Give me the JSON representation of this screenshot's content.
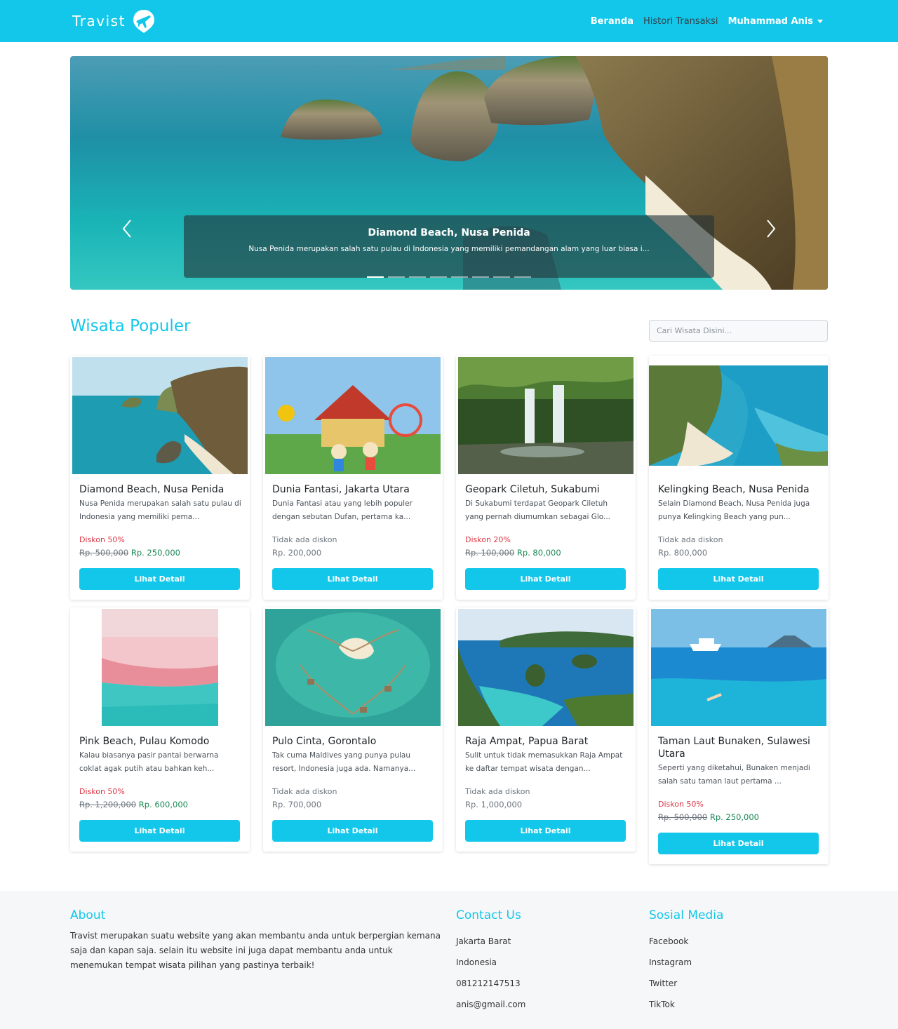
{
  "navbar": {
    "brand": "Travist",
    "links": [
      {
        "label": "Beranda"
      },
      {
        "label": "Histori Transaksi"
      },
      {
        "label": "Muhammad Anis"
      }
    ]
  },
  "carousel": {
    "caption_title": "Diamond Beach, Nusa Penida",
    "caption_text": "Nusa Penida merupakan salah satu pulau di Indonesia yang memiliki pemandangan alam yang luar biasa i...",
    "slide_count": 8,
    "active_index": 0
  },
  "section": {
    "title": "Wisata Populer",
    "search_placeholder": "Cari Wisata Disini..."
  },
  "cards": [
    {
      "title": "Diamond Beach, Nusa Penida",
      "desc": "Nusa Penida merupakan salah satu pulau di Indonesia yang memiliki pema...",
      "discount": "Diskon 50%",
      "old_price": "Rp. 500,000",
      "price": "Rp. 250,000",
      "button": "Lihat Detail"
    },
    {
      "title": "Dunia Fantasi, Jakarta Utara",
      "desc": "Dunia Fantasi atau yang lebih populer dengan sebutan Dufan, pertama ka...",
      "discount": "Tidak ada diskon",
      "old_price": "",
      "price": "Rp. 200,000",
      "button": "Lihat Detail"
    },
    {
      "title": "Geopark Ciletuh, Sukabumi",
      "desc": "Di Sukabumi terdapat Geopark Ciletuh yang pernah diumumkan sebagai Glo...",
      "discount": "Diskon 20%",
      "old_price": "Rp. 100,000",
      "price": "Rp. 80,000",
      "button": "Lihat Detail"
    },
    {
      "title": "Kelingking Beach, Nusa Penida",
      "desc": "Selain Diamond Beach, Nusa Penida juga punya Kelingking Beach yang pun...",
      "discount": "Tidak ada diskon",
      "old_price": "",
      "price": "Rp. 800,000",
      "button": "Lihat Detail"
    },
    {
      "title": "Pink Beach, Pulau Komodo",
      "desc": "Kalau biasanya pasir pantai berwarna coklat agak putih atau bahkan keh...",
      "discount": "Diskon 50%",
      "old_price": "Rp. 1,200,000",
      "price": "Rp. 600,000",
      "button": "Lihat Detail"
    },
    {
      "title": "Pulo Cinta, Gorontalo",
      "desc": "Tak cuma Maldives yang punya pulau resort, Indonesia juga ada. Namanya...",
      "discount": "Tidak ada diskon",
      "old_price": "",
      "price": "Rp. 700,000",
      "button": "Lihat Detail"
    },
    {
      "title": "Raja Ampat, Papua Barat",
      "desc": "Sulit untuk tidak memasukkan Raja Ampat ke daftar tempat wisata dengan...",
      "discount": "Tidak ada diskon",
      "old_price": "",
      "price": "Rp. 1,000,000",
      "button": "Lihat Detail"
    },
    {
      "title": "Taman Laut Bunaken, Sulawesi Utara",
      "desc": "Seperti yang diketahui, Bunaken menjadi salah satu taman laut pertama ...",
      "discount": "Diskon 50%",
      "old_price": "Rp. 500,000",
      "price": "Rp. 250,000",
      "button": "Lihat Detail"
    }
  ],
  "footer": {
    "about_title": "About",
    "about_text": "Travist merupakan suatu website yang akan membantu anda untuk berpergian kemana saja dan kapan saja. selain itu website ini juga dapat membantu anda untuk menemukan tempat wisata pilihan yang pastinya terbaik!",
    "contact_title": "Contact Us",
    "contact_items": [
      "Jakarta Barat",
      "Indonesia",
      "081212147513",
      "anis@gmail.com"
    ],
    "social_title": "Sosial Media",
    "social_items": [
      "Facebook",
      "Instagram",
      "Twitter",
      "TikTok"
    ]
  },
  "colors": {
    "brand": "#13c7ea",
    "discount": "#dc3545",
    "new_price": "#198754",
    "muted": "#6c757d"
  },
  "icons": {
    "brand_logo": "plane-pin-icon",
    "dropdown": "caret-down-icon",
    "carousel_prev": "chevron-left-icon",
    "carousel_next": "chevron-right-icon"
  }
}
